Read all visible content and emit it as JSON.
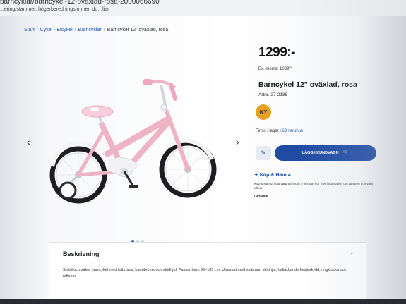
{
  "browser": {
    "url": "barncyklar/barncykel-12-ovaxlad-rosa-2000066690",
    "notice": "...ering/stammer, högerberedningsformer, du…liar"
  },
  "breadcrumb": {
    "start": "Start",
    "sep": "/",
    "category1": "Cykel - Elcykel",
    "category2": "Barncyklar",
    "current": "Barncykel 12\" oväxlad, rosa"
  },
  "product": {
    "price": "1299:-",
    "ex_moms_label": "Ex. moms:",
    "ex_moms_value": "1039",
    "ex_moms_cents": "20",
    "title": "Barncykel 12\" oväxlad, rosa",
    "artnr": "Artnr. 27-2186",
    "badge": "NY",
    "stock_prefix": "Finns i lager i",
    "stock_link": "63 varuhus",
    "add_to_cart": "LÄGG I KUNDVAGN",
    "image_dots": 3,
    "active_dot": 0
  },
  "pickup": {
    "title": "Köp & Hämta",
    "text": "Köp & Hämta i ditt varuhus inom 2 timmar! För mer information om tjänsten och våra villkor.",
    "read_more": "LÄS MER →"
  },
  "description": {
    "title": "Beskrivning",
    "text": "Stabil och säker barncykel med fotbroms, handbroms och stödhjul. Passar barn 90–105 cm. Utrustad med skärmar, stödhjul, heltäckande kedjeskydd, ringklocka och reflexer."
  },
  "icons": {
    "prev": "chevron-left-icon",
    "next": "chevron-right-icon",
    "edit": "edit-icon",
    "cart": "cart-icon",
    "pickup": "pickup-icon",
    "expand": "chevron-down-icon"
  },
  "colors": {
    "accent": "#1f4ba3",
    "badge": "#e8a020",
    "link": "#1b4fae",
    "bike_frame": "#efb3c6"
  }
}
